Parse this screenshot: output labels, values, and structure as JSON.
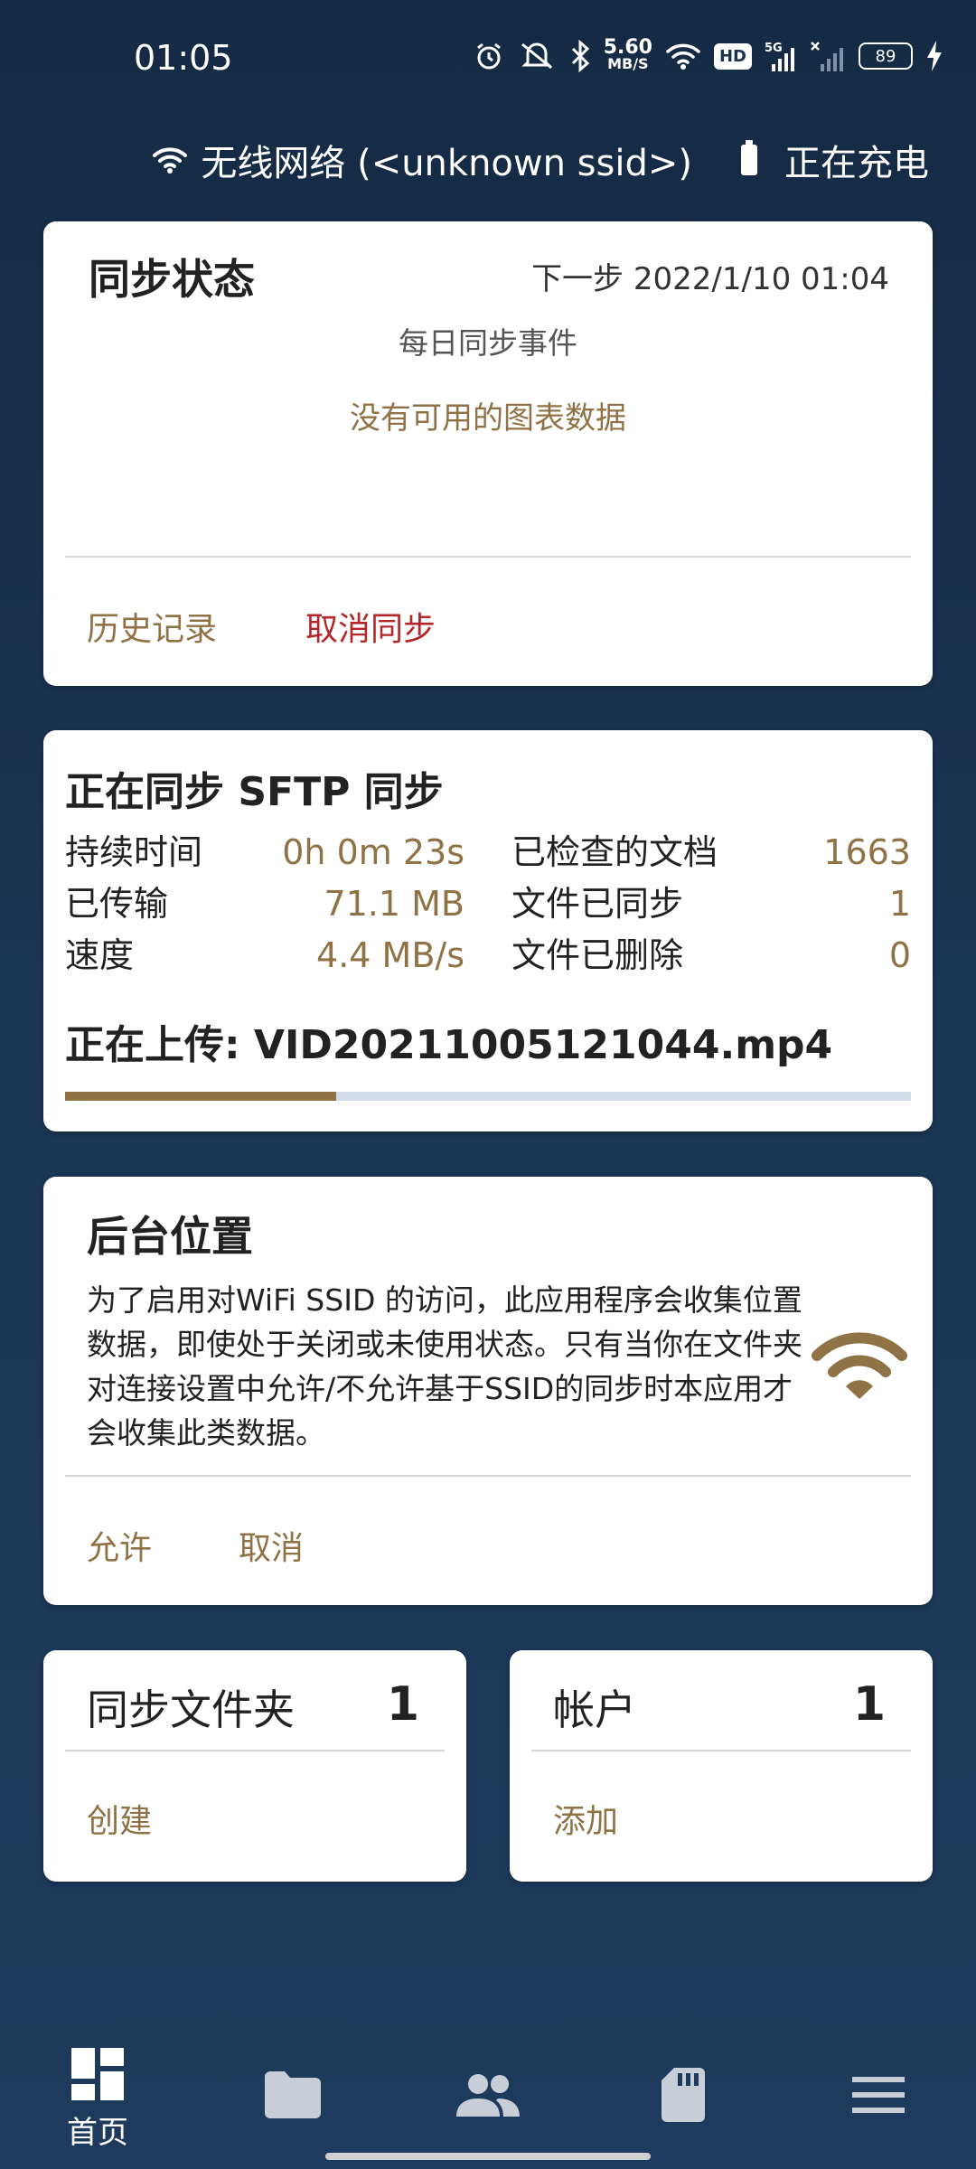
{
  "status_bar": {
    "time": "01:05",
    "speed_value": "5.60",
    "speed_unit": "MB/S",
    "hd_label": "HD",
    "network_label": "5G",
    "battery": "89",
    "icons": [
      "alarm-icon",
      "mute-icon",
      "bluetooth-icon",
      "wifi-icon",
      "hd-icon",
      "signal-icon",
      "no-signal-icon",
      "battery-icon",
      "charging-icon"
    ]
  },
  "network_line": {
    "wifi_text": "无线网络 (<unknown ssid>)",
    "charging_text": "正在充电"
  },
  "sync_status": {
    "title": "同步状态",
    "next_step": "下一步 2022/1/10 01:04",
    "subtitle": "每日同步事件",
    "no_data": "没有可用的图表数据",
    "history_button": "历史记录",
    "cancel_button": "取消同步"
  },
  "sync_progress": {
    "title": "正在同步 SFTP 同步",
    "duration_label": "持续时间",
    "duration_value": "0h 0m 23s",
    "transferred_label": "已传输",
    "transferred_value": "71.1 MB",
    "speed_label": "速度",
    "speed_value": "4.4 MB/s",
    "checked_label": "已检查的文档",
    "checked_value": "1663",
    "synced_label": "文件已同步",
    "synced_value": "1",
    "deleted_label": "文件已删除",
    "deleted_value": "0",
    "uploading": "正在上传: VID20211005121044.mp4",
    "progress_fraction": 0.32
  },
  "background_location": {
    "title": "后台位置",
    "description": "为了启用对WiFi SSID 的访问，此应用程序会收集位置数据，即使处于关闭或未使用状态。只有当你在文件夹对连接设置中允许/不允许基于SSID的同步时本应用才会收集此类数据。",
    "allow_button": "允许",
    "cancel_button": "取消",
    "icon": "wifi-icon"
  },
  "folders": {
    "label": "同步文件夹",
    "count": "1",
    "action": "创建"
  },
  "accounts": {
    "label": "帐户",
    "count": "1",
    "action": "添加"
  },
  "bottom_nav": {
    "home_label": "首页",
    "items": [
      "home-icon",
      "folder-icon",
      "people-icon",
      "sd-card-icon",
      "menu-icon"
    ]
  },
  "colors": {
    "accent": "#8f7245",
    "danger": "#b3262a",
    "background": "#1b3554"
  }
}
